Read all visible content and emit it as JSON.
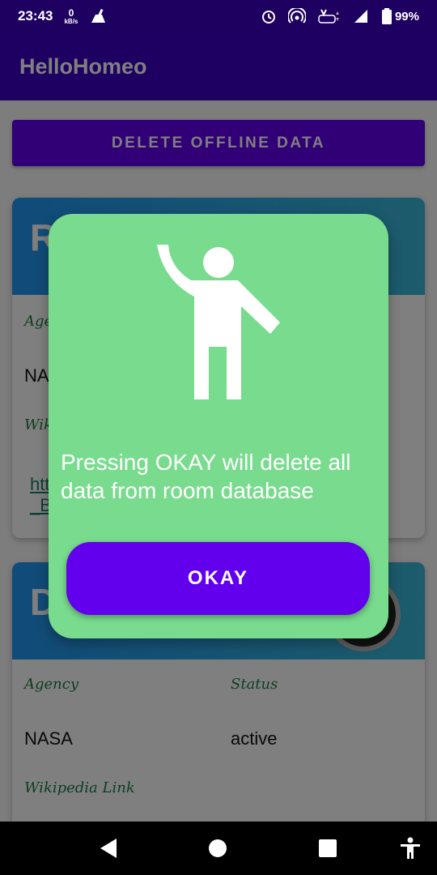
{
  "status_bar": {
    "time": "23:43",
    "net_speed_value": "0",
    "net_speed_unit": "kB/s",
    "battery": "99%",
    "icons": [
      "broom-icon",
      "alarm-icon",
      "hotspot-icon",
      "volte-icon",
      "signal-icon",
      "battery-icon"
    ]
  },
  "app_bar": {
    "title": "HelloHomeo"
  },
  "main": {
    "delete_button_label": "DELETE OFFLINE DATA",
    "cards": [
      {
        "title_partial": "R",
        "agency_label_partial": "Age",
        "agency_value_partial": "NA",
        "wiki_label_partial": "Wik",
        "link_line1_partial": "htt",
        "link_line2_partial": "_B"
      },
      {
        "title_partial": "D",
        "agency_label": "Agency",
        "status_label": "Status",
        "agency_value": "NASA",
        "status_value": "active",
        "wiki_label": "Wikipedia Link"
      }
    ]
  },
  "dialog": {
    "icon": "waving-person-icon",
    "message": "Pressing OKAY will delete all data from room database",
    "okay_label": "OKAY",
    "background": "#79db8e",
    "button_color": "#6200ee"
  },
  "nav_bar": {
    "icons": [
      "back-icon",
      "home-icon",
      "recents-icon",
      "accessibility-icon"
    ]
  }
}
